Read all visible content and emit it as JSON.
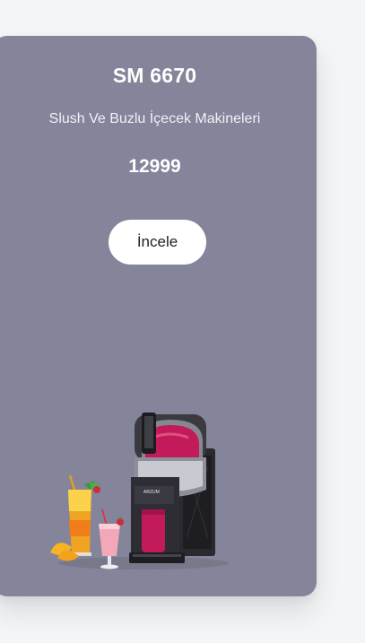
{
  "product": {
    "name": "SM 6670",
    "category": "Slush Ve Buzlu İçecek Makineleri",
    "price": "12999",
    "cta_label": "İncele",
    "image_icon": "slush-machine-with-drinks",
    "machine_brand": "ARZUM"
  },
  "colors": {
    "card_bg": "#84849a",
    "button_bg": "#ffffff",
    "slush_color": "#c21a5a"
  }
}
